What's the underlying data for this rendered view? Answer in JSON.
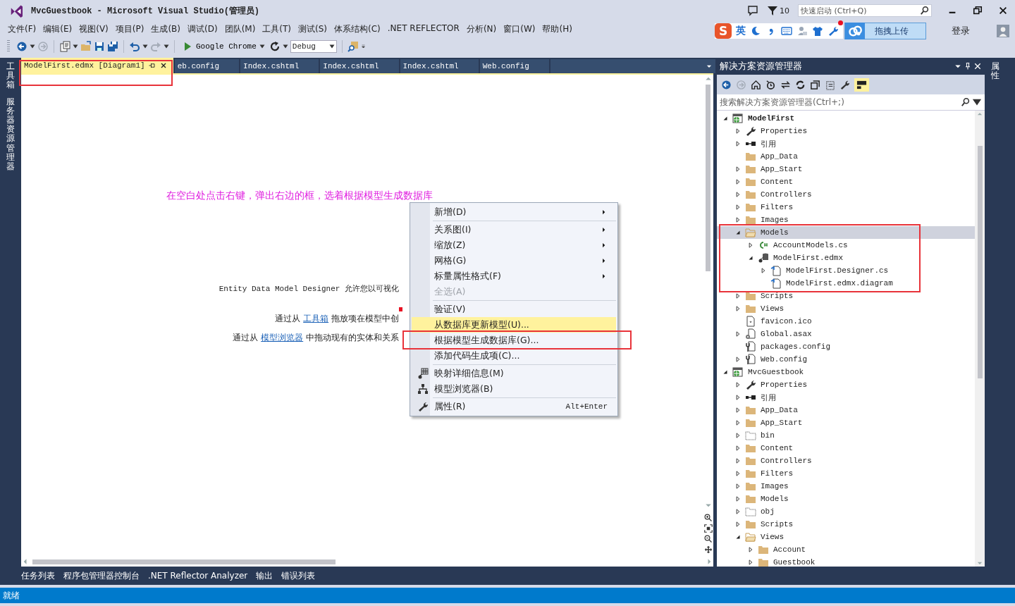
{
  "window": {
    "title": "MvcGuestbook - Microsoft Visual Studio(管理员)",
    "notification_count": "10",
    "quick_launch": {
      "placeholder": "快速启动 (Ctrl+Q)"
    }
  },
  "menu_bar": [
    "文件(F)",
    "编辑(E)",
    "视图(V)",
    "项目(P)",
    "生成(B)",
    "调试(D)",
    "团队(M)",
    "工具(T)",
    "测试(S)",
    "体系结构(C)",
    ".NET REFLECTOR",
    "分析(N)",
    "窗口(W)",
    "帮助(H)"
  ],
  "ime_bar": {
    "logo": "S",
    "mode": "英",
    "upload_button": "拖拽上传",
    "login": "登录"
  },
  "toolbar": {
    "browser": "Google Chrome",
    "configuration": "Debug"
  },
  "left_strip": [
    "工具箱",
    "服务器资源管理器"
  ],
  "document_tabs": [
    {
      "label": "ModelFirst.edmx [Diagram1]",
      "selected": true
    },
    {
      "label": "eb.config",
      "selected": false
    },
    {
      "label": "Index.cshtml",
      "selected": false
    },
    {
      "label": "Index.cshtml",
      "selected": false
    },
    {
      "label": "Index.cshtml",
      "selected": false
    },
    {
      "label": "Web.config",
      "selected": false
    }
  ],
  "editor": {
    "annotation": "在空白处点击右键，弹出右边的框，选着根据模型生成数据库",
    "intro": "Entity Data Model Designer 允许您以可视化",
    "toolbox_line": {
      "before": "通过从",
      "link": "工具箱",
      "after": "拖放项在模型中创"
    },
    "browser_line": {
      "before": "通过从",
      "link": "模型浏览器",
      "after": "中拖动现有的实体和关系"
    }
  },
  "context_menu": {
    "groups": [
      [
        {
          "label": "新增(D)",
          "kind": "submenu",
          "disabled": false,
          "selected": false
        }
      ],
      [
        {
          "label": "关系图(I)",
          "kind": "submenu",
          "disabled": false,
          "selected": false
        },
        {
          "label": "缩放(Z)",
          "kind": "submenu",
          "disabled": false,
          "selected": false
        },
        {
          "label": "网格(G)",
          "kind": "submenu",
          "disabled": false,
          "selected": false
        },
        {
          "label": "标量属性格式(F)",
          "kind": "submenu",
          "disabled": false,
          "selected": false
        },
        {
          "label": "全选(A)",
          "kind": "command",
          "disabled": true,
          "selected": false
        }
      ],
      [
        {
          "label": "验证(V)",
          "kind": "command",
          "disabled": false,
          "selected": false
        },
        {
          "label": "从数据库更新模型(U)...",
          "kind": "command",
          "disabled": false,
          "selected": true
        },
        {
          "label": "根据模型生成数据库(G)...",
          "kind": "command",
          "disabled": false,
          "selected": false
        },
        {
          "label": "添加代码生成项(C)...",
          "kind": "command",
          "disabled": false,
          "selected": false
        }
      ],
      [
        {
          "label": "映射详细信息(M)",
          "kind": "mapping",
          "disabled": false,
          "selected": false
        },
        {
          "label": "模型浏览器(B)",
          "kind": "hierarchy",
          "disabled": false,
          "selected": false
        }
      ],
      [
        {
          "label": "属性(R)",
          "kind": "properties",
          "disabled": false,
          "selected": false,
          "shortcut": "Alt+Enter"
        }
      ]
    ]
  },
  "solution_explorer": {
    "title": "解决方案资源管理器",
    "preview_on": true,
    "search": {
      "placeholder": "搜索解决方案资源管理器(Ctrl+;)"
    },
    "tree": [
      {
        "label": "ModelFirst",
        "kind": "project",
        "startup": true,
        "expanded": true,
        "selected": false,
        "children": [
          {
            "label": "Properties",
            "kind": "properties",
            "expanded": false,
            "selected": false
          },
          {
            "label": "引用",
            "kind": "references",
            "expanded": false,
            "selected": false
          },
          {
            "label": "App_Data",
            "kind": "folder",
            "selected": false
          },
          {
            "label": "App_Start",
            "kind": "folder",
            "expanded": false,
            "selected": false
          },
          {
            "label": "Content",
            "kind": "folder",
            "expanded": false,
            "selected": false
          },
          {
            "label": "Controllers",
            "kind": "folder",
            "expanded": false,
            "selected": false
          },
          {
            "label": "Filters",
            "kind": "folder",
            "expanded": false,
            "selected": false
          },
          {
            "label": "Images",
            "kind": "folder",
            "expanded": false,
            "selected": false
          },
          {
            "label": "Models",
            "kind": "folder",
            "expanded": true,
            "selected": true,
            "children": [
              {
                "label": "AccountModels.cs",
                "kind": "csharp",
                "expanded": false,
                "selected": false
              },
              {
                "label": "ModelFirst.edmx",
                "kind": "edmx",
                "expanded": true,
                "selected": false,
                "children": [
                  {
                    "label": "ModelFirst.Designer.cs",
                    "kind": "code",
                    "expanded": false,
                    "selected": false
                  },
                  {
                    "label": "ModelFirst.edmx.diagram",
                    "kind": "code",
                    "selected": false
                  }
                ]
              }
            ]
          },
          {
            "label": "Scripts",
            "kind": "folder",
            "expanded": false,
            "selected": false
          },
          {
            "label": "Views",
            "kind": "folder",
            "expanded": false,
            "selected": false
          },
          {
            "label": "favicon.ico",
            "kind": "image",
            "selected": false
          },
          {
            "label": "Global.asax",
            "kind": "asax",
            "expanded": false,
            "selected": false
          },
          {
            "label": "packages.config",
            "kind": "config",
            "selected": false
          },
          {
            "label": "Web.config",
            "kind": "config",
            "expanded": false,
            "selected": false
          }
        ]
      },
      {
        "label": "MvcGuestbook",
        "kind": "project",
        "startup": false,
        "expanded": true,
        "selected": false,
        "children": [
          {
            "label": "Properties",
            "kind": "properties",
            "expanded": false,
            "selected": false
          },
          {
            "label": "引用",
            "kind": "references",
            "expanded": false,
            "selected": false
          },
          {
            "label": "App_Data",
            "kind": "folder",
            "expanded": false,
            "selected": false
          },
          {
            "label": "App_Start",
            "kind": "folder",
            "expanded": false,
            "selected": false
          },
          {
            "label": "bin",
            "kind": "hidden-folder",
            "expanded": false,
            "selected": false
          },
          {
            "label": "Content",
            "kind": "folder",
            "expanded": false,
            "selected": false
          },
          {
            "label": "Controllers",
            "kind": "folder",
            "expanded": false,
            "selected": false
          },
          {
            "label": "Filters",
            "kind": "folder",
            "expanded": false,
            "selected": false
          },
          {
            "label": "Images",
            "kind": "folder",
            "expanded": false,
            "selected": false
          },
          {
            "label": "Models",
            "kind": "folder",
            "expanded": false,
            "selected": false
          },
          {
            "label": "obj",
            "kind": "hidden-folder",
            "expanded": false,
            "selected": false
          },
          {
            "label": "Scripts",
            "kind": "folder",
            "expanded": false,
            "selected": false
          },
          {
            "label": "Views",
            "kind": "folder",
            "expanded": true,
            "selected": false,
            "children": [
              {
                "label": "Account",
                "kind": "folder",
                "expanded": false,
                "selected": false
              },
              {
                "label": "Guestbook",
                "kind": "folder",
                "expanded": false,
                "selected": false
              }
            ]
          }
        ]
      }
    ]
  },
  "right_strip": [
    "属性"
  ],
  "bottom_tabs": [
    "任务列表",
    "程序包管理器控制台",
    ".NET Reflector Analyzer",
    "输出",
    "错误列表"
  ],
  "status_bar": "就绪"
}
